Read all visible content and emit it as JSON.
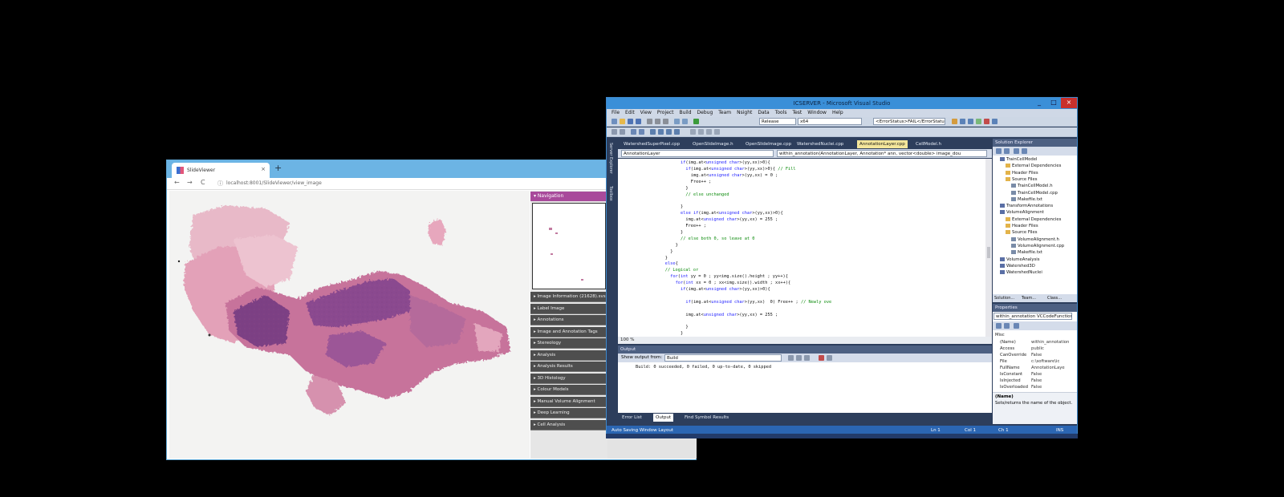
{
  "browser": {
    "tab_title": "SlideViewer",
    "new_tab": "+",
    "tab_close": "×",
    "nav_back": "←",
    "nav_forward": "→",
    "nav_reload": "C",
    "url": "localhost:8001/SlideViewer/view_image",
    "sidebar": {
      "navigation_label": "Navigation",
      "sections": [
        "Image Information (21628).svs",
        "Label Image",
        "Annotations",
        "Image and Annotation Tags",
        "Stereology",
        "Analysis",
        "Analysis Results",
        "3D Histology",
        "Colour Models",
        "Manual Volume Alignment",
        "Deep Learning",
        "Cell Analysis"
      ]
    }
  },
  "vs": {
    "title": "ICSERVER - Microsoft Visual Studio",
    "window_buttons": [
      "_",
      "□",
      "×"
    ],
    "menu": [
      "File",
      "Edit",
      "View",
      "Project",
      "Build",
      "Debug",
      "Team",
      "Nsight",
      "Data",
      "Tools",
      "Test",
      "Window",
      "Help"
    ],
    "toolbar": {
      "config": "Release",
      "platform": "x64",
      "search": "<ErrorStatus>FAIL</ErrorStatus>"
    },
    "side_strips": [
      "Server Explorer",
      "Toolbox"
    ],
    "doc_tabs": [
      {
        "label": "WatershedSuperPixel.cpp",
        "active": false
      },
      {
        "label": "OpenSlideImage.h",
        "active": false
      },
      {
        "label": "OpenSlideImage.cpp",
        "active": false
      },
      {
        "label": "WatershedNuclei.cpp",
        "active": false
      },
      {
        "label": "AnnotationLayer.cpp",
        "active": true
      },
      {
        "label": "CellModel.h",
        "active": false
      }
    ],
    "nav": {
      "left": "AnnotationLayer",
      "right": "within_annotation(AnnotationLayer, Annotation* ann, vector<double> image_dou"
    },
    "code": [
      {
        "i": 10,
        "t": "if(img.at<unsigned char>(yy,xx)>0){"
      },
      {
        "i": 12,
        "t": "if(img.at<unsigned char>(yy,xx)>0){ // Fill"
      },
      {
        "i": 14,
        "t": "img.at<unsigned char>(yy,xx) = 0 ;"
      },
      {
        "i": 14,
        "t": "Free++ ;"
      },
      {
        "i": 12,
        "t": "}"
      },
      {
        "i": 12,
        "t": "// else unchanged"
      },
      {
        "i": 0,
        "t": ""
      },
      {
        "i": 10,
        "t": "}"
      },
      {
        "i": 10,
        "t": "else if(img.at<unsigned char>(yy,xx)>0){"
      },
      {
        "i": 12,
        "t": "img.at<unsigned char>(yy,xx) = 255 ;"
      },
      {
        "i": 12,
        "t": "Free++ ;"
      },
      {
        "i": 10,
        "t": "}"
      },
      {
        "i": 10,
        "t": "// else both 0, so leave at 0"
      },
      {
        "i": 8,
        "t": "}"
      },
      {
        "i": 6,
        "t": "}"
      },
      {
        "i": 4,
        "t": "}"
      },
      {
        "i": 4,
        "t": "else{"
      },
      {
        "i": 4,
        "t": "// Logical or"
      },
      {
        "i": 6,
        "t": "for(int yy = 0 ; yy<img.size().height ; yy++){"
      },
      {
        "i": 8,
        "t": "for(int xx = 0 ; xx<img.size().width ; xx++){"
      },
      {
        "i": 10,
        "t": "if(img.at<unsigned char>(yy,xx)>0){"
      },
      {
        "i": 0,
        "t": ""
      },
      {
        "i": 12,
        "t": "if(img.at<unsigned char>(yy,xx)  0) Free++ ; // Newly ove"
      },
      {
        "i": 0,
        "t": ""
      },
      {
        "i": 12,
        "t": "img.at<unsigned char>(yy,xx) = 255 ;"
      },
      {
        "i": 0,
        "t": ""
      },
      {
        "i": 12,
        "t": "}"
      },
      {
        "i": 10,
        "t": "}"
      }
    ],
    "zoom": "100 %",
    "output": {
      "title": "Output",
      "show_from_label": "Show output from:",
      "show_from_value": "Build",
      "text": "Build: 0 succeeded, 0 failed, 0 up-to-date, 0 skipped"
    },
    "bottom_tabs": [
      "Error List",
      "Output",
      "Find Symbol Results"
    ],
    "status": {
      "left": "Auto Saving Window Layout",
      "ln": "Ln 1",
      "col": "Col 1",
      "ch": "Ch 1",
      "ins": "INS"
    },
    "solution_explorer": {
      "title": "Solution Explorer",
      "items": [
        {
          "level": 1,
          "icon": "project",
          "label": "TrainCellModel"
        },
        {
          "level": 2,
          "icon": "folder",
          "label": "External Dependencies"
        },
        {
          "level": 2,
          "icon": "folder",
          "label": "Header Files"
        },
        {
          "level": 2,
          "icon": "folder",
          "label": "Source Files"
        },
        {
          "level": 3,
          "icon": "file",
          "label": "TrainCellModel.h"
        },
        {
          "level": 3,
          "icon": "file",
          "label": "TrainCellModel.cpp"
        },
        {
          "level": 3,
          "icon": "file",
          "label": "Makefile.txt"
        },
        {
          "level": 1,
          "icon": "project",
          "label": "TransformAnnotations"
        },
        {
          "level": 1,
          "icon": "project",
          "label": "VolumeAlignment"
        },
        {
          "level": 2,
          "icon": "folder",
          "label": "External Dependencies"
        },
        {
          "level": 2,
          "icon": "folder",
          "label": "Header Files"
        },
        {
          "level": 2,
          "icon": "folder",
          "label": "Source Files"
        },
        {
          "level": 3,
          "icon": "file",
          "label": "VolumeAlignment.h"
        },
        {
          "level": 3,
          "icon": "file",
          "label": "VolumeAlignment.cpp"
        },
        {
          "level": 3,
          "icon": "file",
          "label": "Makefile.txt"
        },
        {
          "level": 1,
          "icon": "project",
          "label": "VolumeAnalysis"
        },
        {
          "level": 1,
          "icon": "project",
          "label": "Watershed3D"
        },
        {
          "level": 1,
          "icon": "project",
          "label": "WatershedNuclei"
        }
      ],
      "footer_tabs": [
        "Solution...",
        "Team...",
        "Class..."
      ]
    },
    "properties": {
      "title": "Properties",
      "selector": "within_annotation VCCodeFunction",
      "category": "Misc",
      "rows": [
        {
          "name": "(Name)",
          "value": "within_annotation"
        },
        {
          "name": "Access",
          "value": "public"
        },
        {
          "name": "CanOverride",
          "value": "False"
        },
        {
          "name": "File",
          "value": "c:\\software\\ic"
        },
        {
          "name": "FullName",
          "value": "AnnotationLaye"
        },
        {
          "name": "IsConstant",
          "value": "False"
        },
        {
          "name": "IsInjected",
          "value": "False"
        },
        {
          "name": "IsOverloaded",
          "value": "False"
        }
      ],
      "desc_title": "(Name)",
      "desc_text": "Sets/returns the name of the object."
    }
  }
}
